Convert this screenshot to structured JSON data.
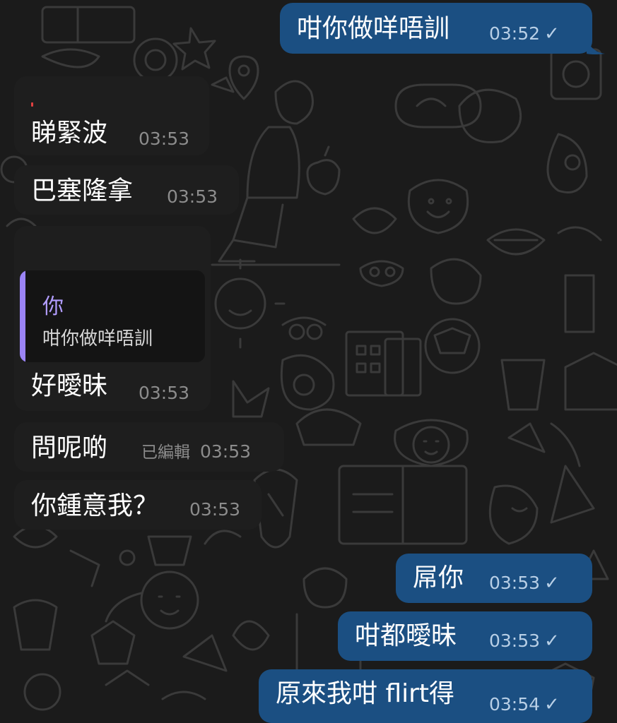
{
  "colors": {
    "background": "#1b1b1b",
    "incoming_bubble": "#1e1e1e",
    "outgoing_bubble": "#1b4f82",
    "reply_accent": "#9b84f5",
    "meta_incoming": "#8c8c8c",
    "meta_outgoing": "#b8cfe6"
  },
  "messages": [
    {
      "direction": "outgoing",
      "text": "咁你做咩唔訓",
      "time": "03:52",
      "status_icon": "check-icon"
    },
    {
      "direction": "incoming",
      "text": "睇緊波",
      "time": "03:53"
    },
    {
      "direction": "incoming",
      "text": "巴塞隆拿",
      "time": "03:53"
    },
    {
      "direction": "incoming",
      "reply": {
        "author": "你",
        "text": "咁你做咩唔訓"
      },
      "text": "好曖昧",
      "time": "03:53"
    },
    {
      "direction": "incoming",
      "text": "問呢啲",
      "edited": "已編輯",
      "time": "03:53"
    },
    {
      "direction": "incoming",
      "text": "你鍾意我？",
      "time": "03:53"
    },
    {
      "direction": "outgoing",
      "text": "屌你",
      "time": "03:53",
      "status_icon": "check-icon"
    },
    {
      "direction": "outgoing",
      "text": "咁都曖昧",
      "time": "03:53",
      "status_icon": "check-icon"
    },
    {
      "direction": "outgoing",
      "text": "原來我咁 flirt得",
      "time": "03:54",
      "status_icon": "check-icon"
    }
  ],
  "check_glyph": "✓"
}
